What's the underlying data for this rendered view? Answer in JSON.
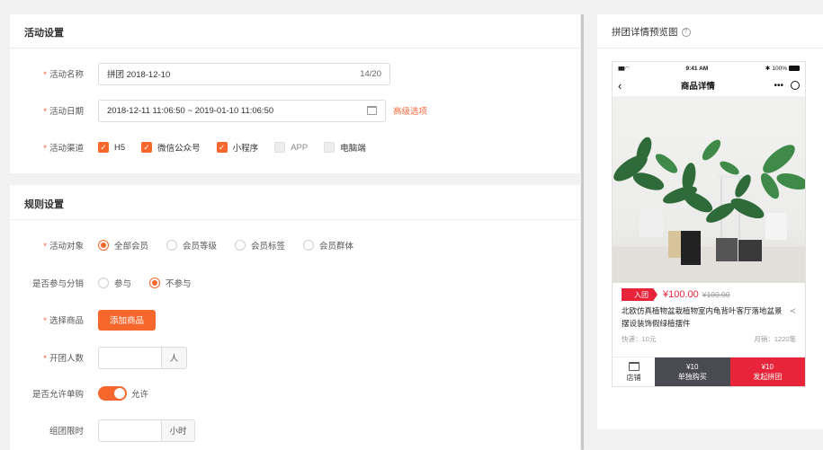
{
  "activity": {
    "title": "活动设置",
    "name_label": "活动名称",
    "name_value": "拼团  2018-12-10",
    "name_counter": "14/20",
    "date_label": "活动日期",
    "date_value": "2018-12-11 11:06:50 ~ 2019-01-10 11:06:50",
    "advanced_link": "高级选项",
    "channel_label": "活动渠道",
    "channels": [
      {
        "label": "H5",
        "checked": true
      },
      {
        "label": "微信公众号",
        "checked": true
      },
      {
        "label": "小程序",
        "checked": true
      },
      {
        "label": "APP",
        "checked": false
      },
      {
        "label": "电脑端",
        "checked": false
      }
    ]
  },
  "rules": {
    "title": "规则设置",
    "target_label": "活动对象",
    "targets": [
      {
        "label": "全部会员",
        "selected": true
      },
      {
        "label": "会员等级",
        "selected": false
      },
      {
        "label": "会员标签",
        "selected": false
      },
      {
        "label": "会员群体",
        "selected": false
      }
    ],
    "distribution_label": "是否参与分销",
    "distribution_options": [
      {
        "label": "参与",
        "selected": false
      },
      {
        "label": "不参与",
        "selected": true
      }
    ],
    "goods_label": "选择商品",
    "add_goods_button": "添加商品",
    "group_size_label": "开团人数",
    "group_size_unit": "人",
    "solo_label": "是否允许单购",
    "solo_toggle_text": "允许",
    "solo_enabled": true,
    "time_limit_label": "组团限时",
    "time_limit_unit": "小时"
  },
  "preview": {
    "title": "拼团详情预览图",
    "status_time": "9:41 AM",
    "status_battery": "100%",
    "nav_title": "商品详情",
    "tag": "入团",
    "price": "¥100.00",
    "old_price": "¥100.00",
    "product_name": "北欧仿真植物盆栽植物室内龟背叶客厅落地盆景摆设装饰假绿植摆件",
    "shipping": "快递：10元",
    "sales": "月销：1220笔",
    "shop_label": "店铺",
    "single_price": "¥10",
    "single_label": "单独购买",
    "group_price": "¥10",
    "group_label": "发起拼团"
  },
  "colors": {
    "accent": "#f5672c",
    "price_red": "#e8243a",
    "dark_button": "#4a4a52"
  }
}
